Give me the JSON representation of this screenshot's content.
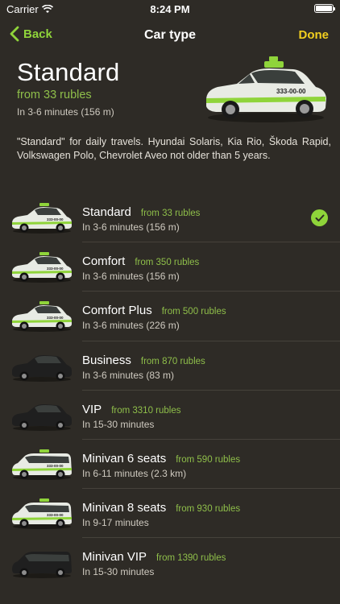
{
  "status_bar": {
    "carrier": "Carrier",
    "time": "8:24 PM"
  },
  "nav": {
    "back_label": "Back",
    "title": "Car type",
    "done_label": "Done"
  },
  "selected": {
    "name": "Standard",
    "price": "from 33 rubles",
    "eta": "In 3-6 minutes (156 m)",
    "description": "\"Standard\" for daily travels. Hyundai Solaris, Kia Rio, Škoda Rapid, Volkswagen Polo, Chevrolet Aveo not older than 5 years.",
    "sign": "333-00-00"
  },
  "car_types": [
    {
      "name": "Standard",
      "price": "from 33 rubles",
      "eta": "In 3-6 minutes (156 m)",
      "selected": true,
      "color": "white-green",
      "sign": "333-00-00"
    },
    {
      "name": "Comfort",
      "price": "from 350 rubles",
      "eta": "In 3-6 minutes (156 m)",
      "selected": false,
      "color": "white-green",
      "sign": "333-00-00"
    },
    {
      "name": "Comfort Plus",
      "price": "from 500 rubles",
      "eta": "In 3-6 minutes (226 m)",
      "selected": false,
      "color": "white-green",
      "sign": "333-00-00"
    },
    {
      "name": "Business",
      "price": "from 870 rubles",
      "eta": "In 3-6 minutes (83 m)",
      "selected": false,
      "color": "black",
      "sign": ""
    },
    {
      "name": "VIP",
      "price": "from 3310 rubles",
      "eta": "In 15-30 minutes",
      "selected": false,
      "color": "black",
      "sign": ""
    },
    {
      "name": "Minivan 6 seats",
      "price": "from 590 rubles",
      "eta": "In 6-11 minutes (2.3 km)",
      "selected": false,
      "color": "van-green",
      "sign": "333-00-00"
    },
    {
      "name": "Minivan 8 seats",
      "price": "from 930 rubles",
      "eta": "In 9-17 minutes",
      "selected": false,
      "color": "van-green",
      "sign": "333-00-00"
    },
    {
      "name": "Minivan VIP",
      "price": "from 1390 rubles",
      "eta": "In 15-30 minutes",
      "selected": false,
      "color": "van-black",
      "sign": ""
    }
  ],
  "colors": {
    "accent_green": "#8fd43a",
    "done_yellow": "#f2cf1f",
    "price_green": "#8fbf4a",
    "background": "#2e2b26"
  }
}
